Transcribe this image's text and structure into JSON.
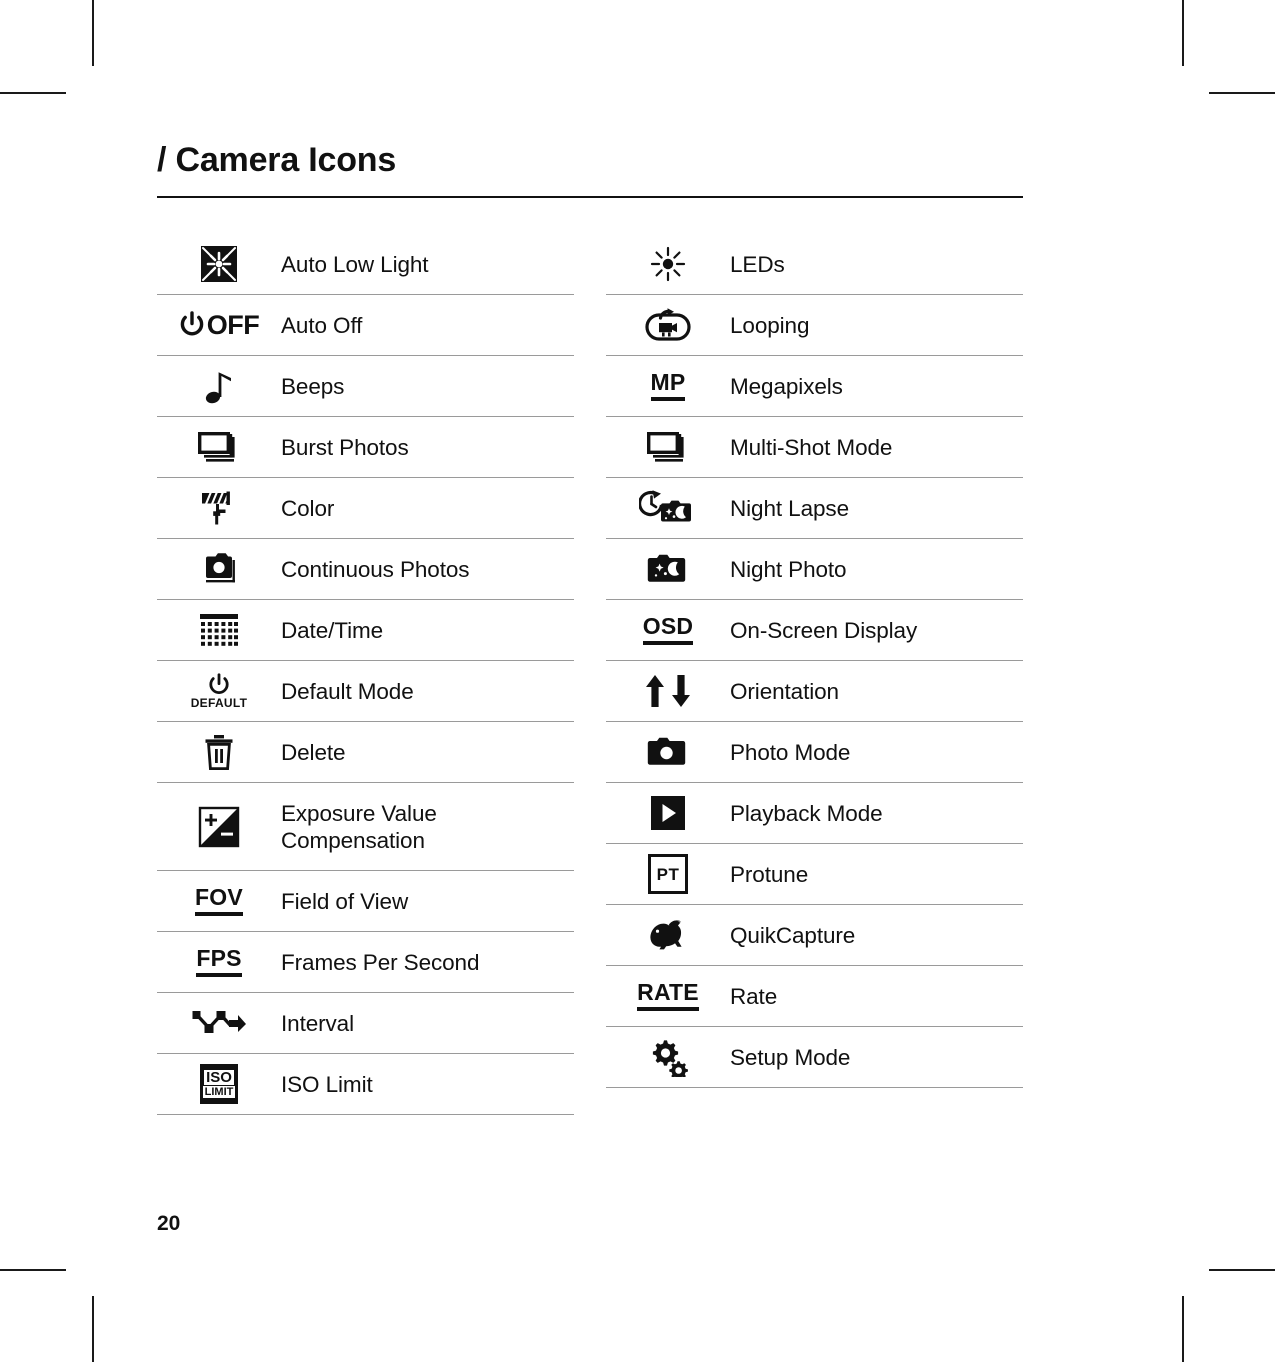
{
  "document": {
    "title": "/ Camera Icons",
    "page_number": "20"
  },
  "colors": {
    "text": "#111111",
    "rule": "#111111",
    "row_separator": "#9a9a9a",
    "background": "#ffffff"
  },
  "left_column": [
    {
      "icon": "auto-low-light-icon",
      "label": "Auto Low Light"
    },
    {
      "icon": "auto-off-icon",
      "label": "Auto Off",
      "glyph": "OFF"
    },
    {
      "icon": "beeps-icon",
      "label": "Beeps"
    },
    {
      "icon": "burst-photos-icon",
      "label": "Burst Photos"
    },
    {
      "icon": "color-icon",
      "label": "Color"
    },
    {
      "icon": "continuous-photos-icon",
      "label": "Continuous Photos"
    },
    {
      "icon": "date-time-icon",
      "label": "Date/Time"
    },
    {
      "icon": "default-mode-icon",
      "label": "Default Mode",
      "glyph": "DEFAULT"
    },
    {
      "icon": "delete-icon",
      "label": "Delete"
    },
    {
      "icon": "exposure-value-compensation-icon",
      "label": "Exposure Value Compensation"
    },
    {
      "icon": "field-of-view-icon",
      "label": "Field of View",
      "glyph": "FOV"
    },
    {
      "icon": "frames-per-second-icon",
      "label": "Frames Per Second",
      "glyph": "FPS"
    },
    {
      "icon": "interval-icon",
      "label": "Interval"
    },
    {
      "icon": "iso-limit-icon",
      "label": "ISO Limit",
      "glyph_top": "ISO",
      "glyph_bottom": "LIMIT"
    }
  ],
  "right_column": [
    {
      "icon": "leds-icon",
      "label": "LEDs"
    },
    {
      "icon": "looping-icon",
      "label": "Looping"
    },
    {
      "icon": "megapixels-icon",
      "label": "Megapixels",
      "glyph": "MP"
    },
    {
      "icon": "multi-shot-mode-icon",
      "label": "Multi-Shot Mode"
    },
    {
      "icon": "night-lapse-icon",
      "label": "Night Lapse"
    },
    {
      "icon": "night-photo-icon",
      "label": "Night Photo"
    },
    {
      "icon": "on-screen-display-icon",
      "label": "On-Screen Display",
      "glyph": "OSD"
    },
    {
      "icon": "orientation-icon",
      "label": "Orientation"
    },
    {
      "icon": "photo-mode-icon",
      "label": "Photo Mode"
    },
    {
      "icon": "playback-mode-icon",
      "label": "Playback Mode"
    },
    {
      "icon": "protune-icon",
      "label": "Protune",
      "glyph": "PT"
    },
    {
      "icon": "quikcapture-icon",
      "label": "QuikCapture"
    },
    {
      "icon": "rate-icon",
      "label": "Rate",
      "glyph": "RATE"
    },
    {
      "icon": "setup-mode-icon",
      "label": "Setup Mode"
    }
  ]
}
